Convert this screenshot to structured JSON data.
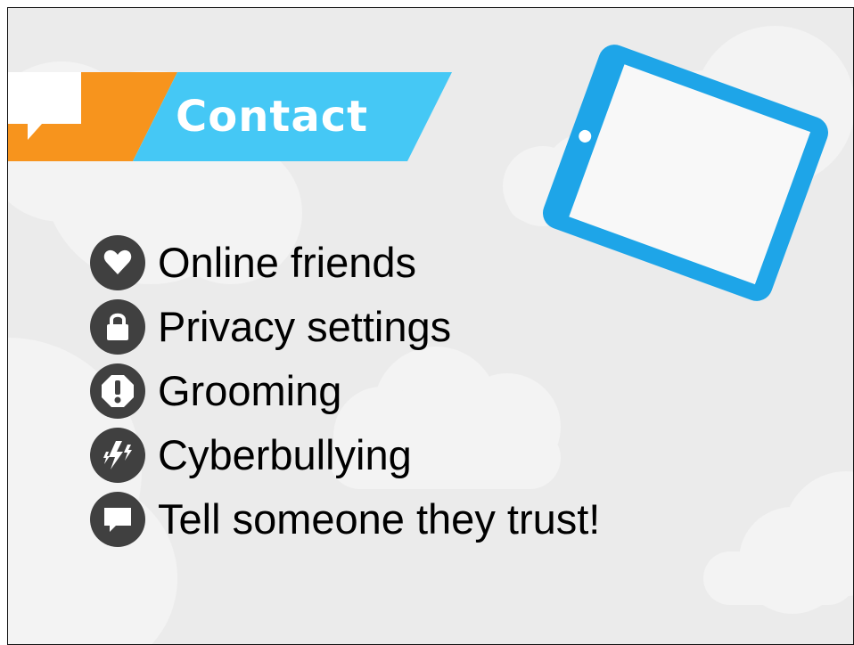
{
  "slide": {
    "title": "Contact",
    "title_icon": "speech-bubble-icon",
    "colors": {
      "background": "#ebebeb",
      "cloud": "#f3f3f3",
      "banner_orange": "#f7941d",
      "banner_blue": "#45c8f5",
      "tablet_blue": "#1ea5e8",
      "icon_circle": "#404040",
      "text": "#000000"
    }
  },
  "topics": [
    {
      "label": "Online friends",
      "icon": "heart-icon"
    },
    {
      "label": "Privacy settings",
      "icon": "padlock-icon"
    },
    {
      "label": "Grooming",
      "icon": "exclamation-icon"
    },
    {
      "label": "Cyberbullying",
      "icon": "lightning-icon"
    },
    {
      "label": "Tell someone they trust!",
      "icon": "speech-bubble-icon"
    }
  ]
}
